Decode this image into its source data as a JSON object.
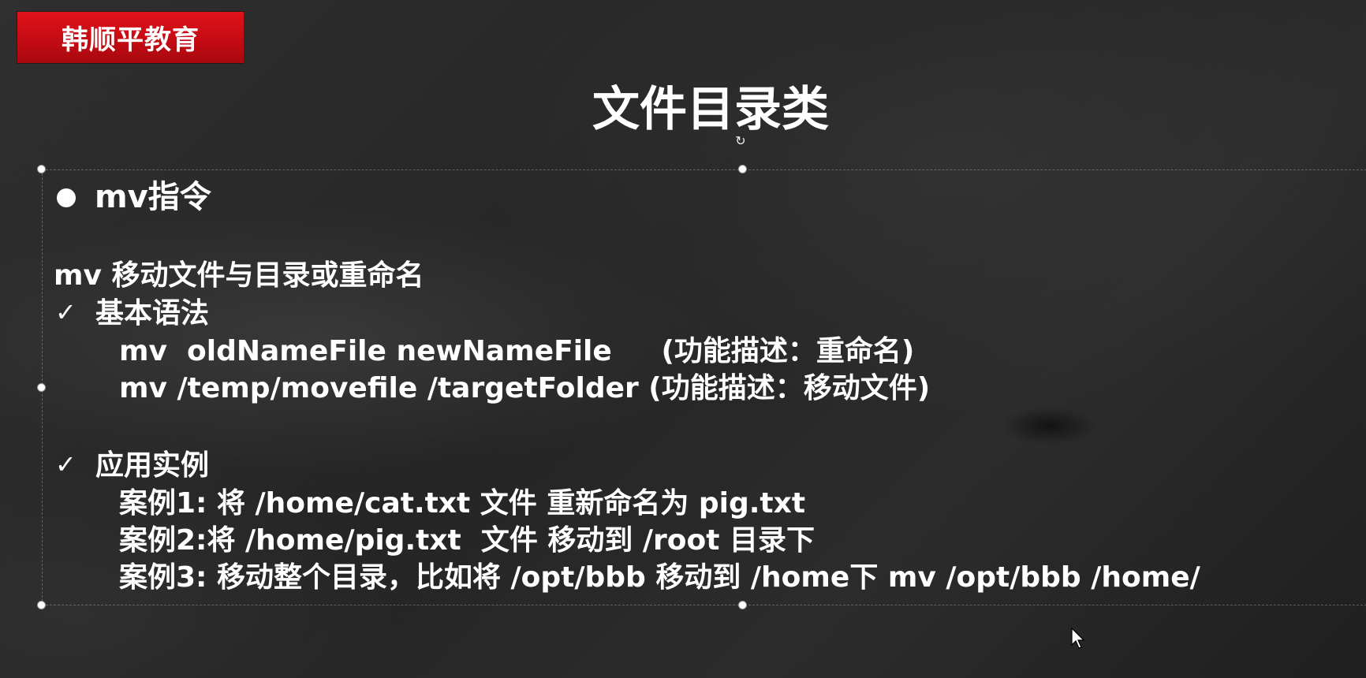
{
  "brand": {
    "label": "韩顺平教育"
  },
  "slide": {
    "title": "文件目录类",
    "heading": "mv指令",
    "description": "mv 移动文件与目录或重命名",
    "syntax_title": "基本语法",
    "syntax_lines": [
      "mv  oldNameFile newNameFile     (功能描述：重命名)",
      "mv /temp/movefile /targetFolder (功能描述：移动文件)"
    ],
    "examples_title": "应用实例",
    "examples": [
      "案例1: 将 /home/cat.txt 文件 重新命名为 pig.txt",
      "案例2:将 /home/pig.txt  文件 移动到 /root 目录下",
      "案例3: 移动整个目录，比如将 /opt/bbb 移动到 /home下 mv /opt/bbb /home/"
    ]
  },
  "icons": {
    "bullet": "filled-circle-icon",
    "check": "checkmark-icon",
    "rotate": "rotate-handle-icon",
    "cursor": "mouse-pointer-icon"
  },
  "colors": {
    "background": "#262626",
    "brand_red": "#d0101a",
    "text": "#ffffff"
  }
}
